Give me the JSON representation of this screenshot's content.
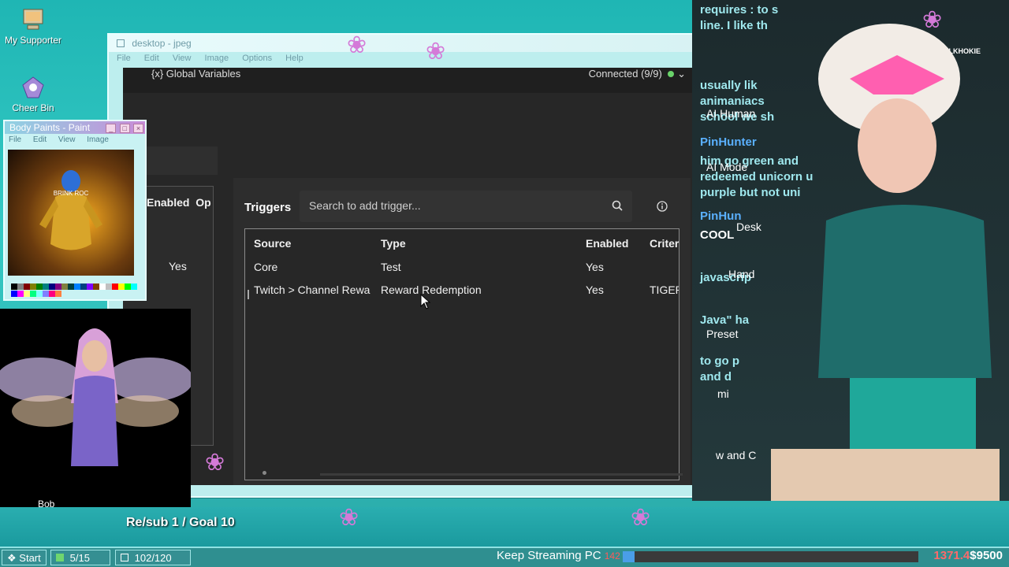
{
  "desktop": {
    "icons": [
      {
        "label": "My Supporter",
        "icon": "computer-icon"
      },
      {
        "label": "Cheer Bin",
        "icon": "recycle-bin-icon"
      }
    ]
  },
  "main_window": {
    "title": "desktop - jpeg",
    "menu": [
      "File",
      "Edit",
      "View",
      "Image",
      "Options",
      "Help"
    ]
  },
  "app": {
    "global_variables": "{x}  Global Variables",
    "connection_status": "Connected (9/9)",
    "left_pane": {
      "headers": [
        "Enabled",
        "Op"
      ],
      "value": "Yes"
    },
    "triggers": {
      "label": "Triggers",
      "search_placeholder": "Search to add trigger...",
      "columns": [
        "Source",
        "Type",
        "Enabled",
        "Criteria"
      ],
      "rows": [
        {
          "source": "Core",
          "type": "Test",
          "enabled": "Yes",
          "criteria": ""
        },
        {
          "source": "Twitch > Channel Reward",
          "type": "Reward Redemption",
          "enabled": "Yes",
          "criteria": "TIGER"
        }
      ]
    }
  },
  "paint_window": {
    "title": "Body Paints - Paint",
    "menu": [
      "File",
      "Edit",
      "View",
      "Image"
    ],
    "canvas_text": "BRINK ROC",
    "palette": [
      "#000000",
      "#808080",
      "#800000",
      "#808000",
      "#008000",
      "#008080",
      "#000080",
      "#800080",
      "#808040",
      "#004040",
      "#0080ff",
      "#004080",
      "#8000ff",
      "#804000",
      "#ffffff",
      "#c0c0c0",
      "#ff0000",
      "#ffff00",
      "#00ff00",
      "#00ffff",
      "#0000ff",
      "#ff00ff",
      "#ffff80",
      "#00ff80",
      "#80ffff",
      "#8080ff",
      "#ff0080",
      "#ff8040"
    ]
  },
  "chat": {
    "lines": [
      {
        "text": "requires : to s",
        "color": "#9fe8ee"
      },
      {
        "text": "line. I like th",
        "color": "#9fe8ee"
      },
      {
        "text": "usually lik",
        "color": "#9fe8ee"
      },
      {
        "text": "animaniacs",
        "color": "#9fe8ee"
      },
      {
        "text": "school we sh",
        "color": "#9fe8ee"
      },
      {
        "text": "PinHunter",
        "color": "#5ab0ff"
      },
      {
        "text": "him go green and",
        "color": "#9fe8ee"
      },
      {
        "text": "redeemed unicorn u",
        "color": "#9fe8ee"
      },
      {
        "text": "purple but not uni",
        "color": "#9fe8ee"
      },
      {
        "text": "PinHun",
        "color": "#5ab0ff"
      },
      {
        "text": "COOL",
        "color": "#ffffff"
      },
      {
        "text": "javascrip",
        "color": "#9fe8ee"
      },
      {
        "text": "Java\" ha",
        "color": "#9fe8ee"
      },
      {
        "text": "to go p",
        "color": "#9fe8ee"
      },
      {
        "text": "and d",
        "color": "#9fe8ee"
      }
    ],
    "overlay_labels": [
      "AI Human",
      "AI Mode",
      "Desk",
      "Hand",
      "Preset",
      "mi",
      "w and C"
    ],
    "watermark": "HULKHOKIE"
  },
  "goal": {
    "text": "Re/sub 1 / Goal 10",
    "name_tag": "Bob"
  },
  "taskbar": {
    "start": "Start",
    "items": [
      "5/15",
      "102/120"
    ]
  },
  "ticker": {
    "text": "Keep Streaming PC",
    "bits": "142"
  },
  "bits_progress": {
    "value": 0.04
  },
  "money": {
    "current": "1371.4",
    "goal": "$9500"
  },
  "colors": {
    "accent": "#35c9c4",
    "app_bg": "#272727",
    "connected": "#6ad36a"
  }
}
